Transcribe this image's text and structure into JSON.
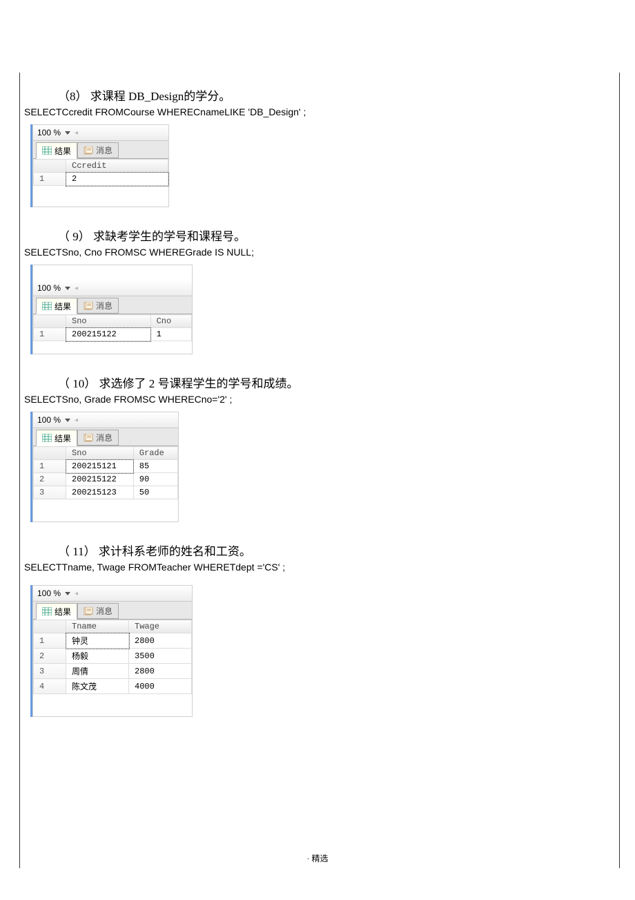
{
  "questions": {
    "q8": {
      "num": "（8）",
      "text": "求课程 DB_Design的学分。"
    },
    "q9": {
      "num": "（ 9）",
      "text": "求缺考学生的学号和课程号。"
    },
    "q10": {
      "num": "（ 10）",
      "text": "求选修了 2 号课程学生的学号和成绩。"
    },
    "q11": {
      "num": "（ 11）",
      "text": "求计科系老师的姓名和工资。"
    }
  },
  "sql": {
    "q8": "SELECTCcredit   FROMCourse  WHERECnameLIKE 'DB_Design' ;",
    "q9": "SELECTSno, Cno FROMSC WHEREGrade IS NULL;",
    "q10": "SELECTSno, Grade FROMSC WHERECno='2'  ;",
    "q11": "SELECTTname, Twage FROMTeacher  WHERETdept ='CS' ;"
  },
  "ui": {
    "zoom": "100 %",
    "tab_result": "结果",
    "tab_message": "消息"
  },
  "chart_data": [
    {
      "type": "table",
      "title": "Q8 Result",
      "headers": [
        "Ccredit"
      ],
      "rows": [
        [
          "2"
        ]
      ]
    },
    {
      "type": "table",
      "title": "Q9 Result",
      "headers": [
        "Sno",
        "Cno"
      ],
      "rows": [
        [
          "200215122",
          "1"
        ]
      ]
    },
    {
      "type": "table",
      "title": "Q10 Result",
      "headers": [
        "Sno",
        "Grade"
      ],
      "rows": [
        [
          "200215121",
          "85"
        ],
        [
          "200215122",
          "90"
        ],
        [
          "200215123",
          "50"
        ]
      ]
    },
    {
      "type": "table",
      "title": "Q11 Result",
      "headers": [
        "Tname",
        "Twage"
      ],
      "rows": [
        [
          "钟灵",
          "2800"
        ],
        [
          "杨毅",
          "3500"
        ],
        [
          "周倩",
          "2800"
        ],
        [
          "陈文茂",
          "4000"
        ]
      ]
    }
  ],
  "row_labels": [
    "1",
    "2",
    "3",
    "4"
  ],
  "footer": "· 精选"
}
